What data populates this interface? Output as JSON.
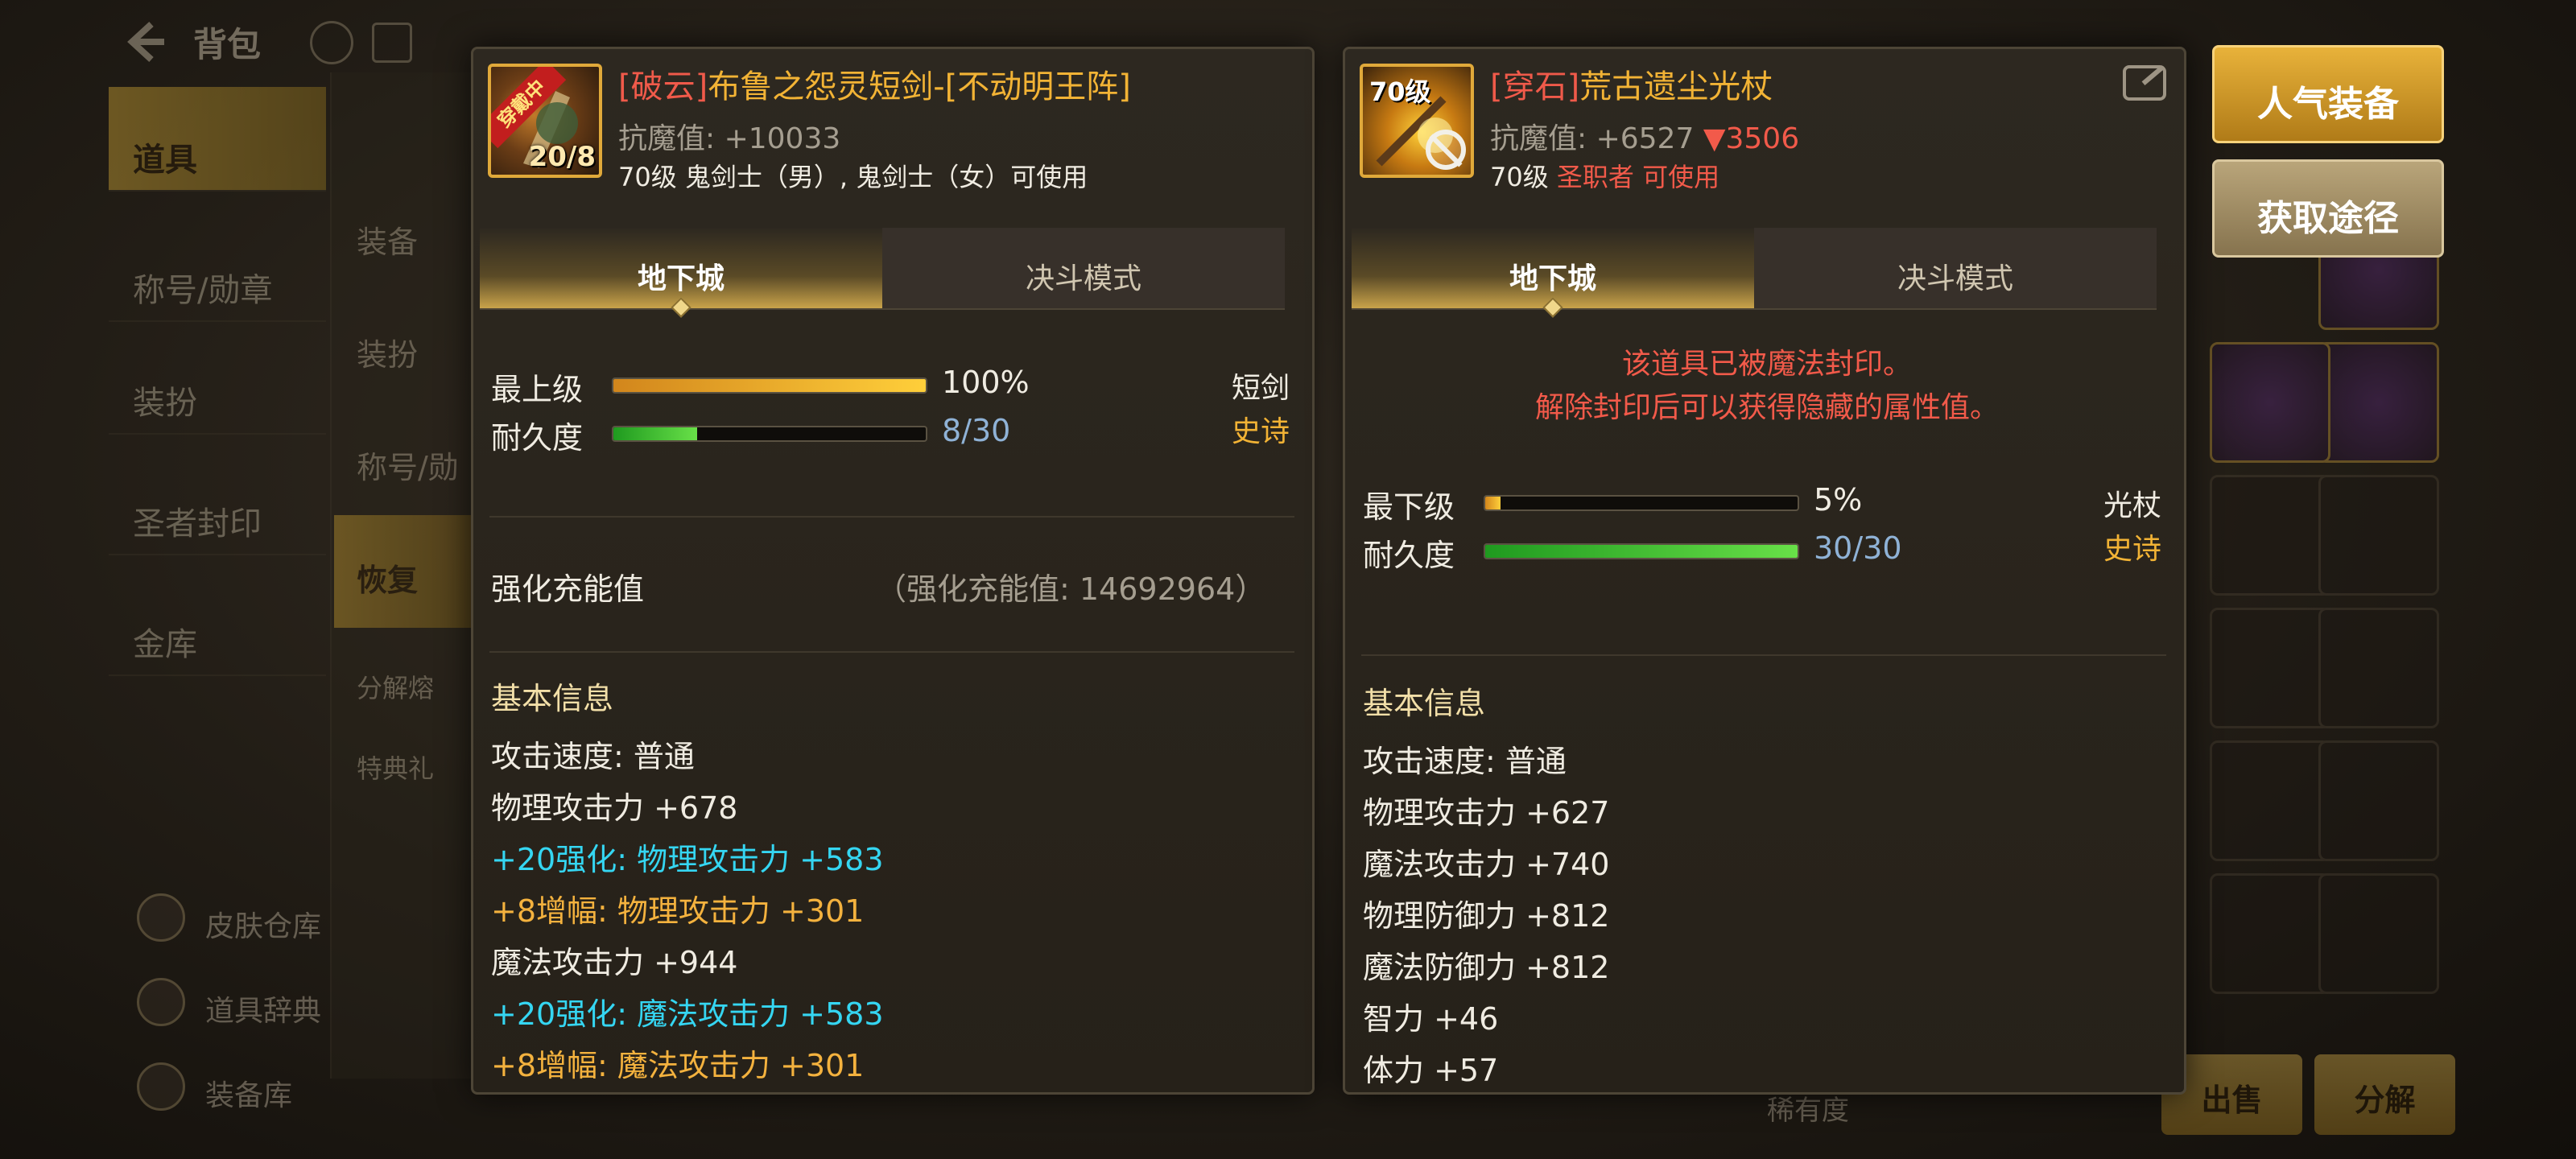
{
  "background": {
    "title": "背包",
    "side_menu": [
      "道具",
      "称号/勋章",
      "装扮",
      "圣者封印",
      "金库"
    ],
    "sub_menu": [
      "装备",
      "装扮",
      "称号/勋",
      "恢复",
      "分解熔",
      "特典礼"
    ],
    "bottom_side": [
      "皮肤仓库",
      "道具辞典",
      "装备库"
    ],
    "buttons": [
      "出售",
      "分解"
    ],
    "sort_label": "稀有度"
  },
  "left_panel": {
    "title_prefix": "[破云]",
    "title_main": "布鲁之怨灵短剑-[不动明王阵]",
    "icon_ribbon": "穿戴中",
    "icon_count": "20/8",
    "resist": "抗魔值: +10033",
    "usable": "70级 鬼剑士（男）, 鬼剑士（女）可使用",
    "tabs": [
      "地下城",
      "决斗模式"
    ],
    "stat1_label": "最上级",
    "stat1_value": "100%",
    "stat1_fill": 1.0,
    "stat2_label": "耐久度",
    "stat2_value": "8/30",
    "stat2_fill": 0.267,
    "category": "短剑",
    "rarity": "史诗",
    "enhance_label": "强化充能值",
    "enhance_value": "（强化充能值: 14692964）",
    "section_title": "基本信息",
    "lines": [
      {
        "text": "攻击速度: 普通",
        "color": "white"
      },
      {
        "text": "物理攻击力 +678",
        "color": "white"
      },
      {
        "text": "+20强化: 物理攻击力 +583",
        "color": "cyan"
      },
      {
        "text": " +8增幅: 物理攻击力 +301",
        "color": "orange"
      },
      {
        "text": "魔法攻击力 +944",
        "color": "white"
      },
      {
        "text": "+20强化: 魔法攻击力 +583",
        "color": "cyan"
      },
      {
        "text": " +8增幅: 魔法攻击力 +301",
        "color": "orange"
      }
    ]
  },
  "right_panel": {
    "title_prefix": "[穿石]",
    "title_main": "荒古遗尘光杖",
    "icon_level": "70级",
    "resist": "抗魔值: +6527",
    "resist_diff": "▼3506",
    "usable_level": "70级",
    "usable_class": "圣职者 可使用",
    "tabs": [
      "地下城",
      "决斗模式"
    ],
    "seal_line1": "该道具已被魔法封印。",
    "seal_line2": "解除封印后可以获得隐藏的属性值。",
    "stat1_label": "最下级",
    "stat1_value": "5%",
    "stat1_fill": 0.05,
    "stat2_label": "耐久度",
    "stat2_value": "30/30",
    "stat2_fill": 1.0,
    "category": "光杖",
    "rarity": "史诗",
    "section_title": "基本信息",
    "lines": [
      {
        "text": "攻击速度: 普通",
        "color": "white"
      },
      {
        "text": "物理攻击力 +627",
        "color": "white"
      },
      {
        "text": "魔法攻击力 +740",
        "color": "white"
      },
      {
        "text": "物理防御力 +812",
        "color": "white"
      },
      {
        "text": "魔法防御力 +812",
        "color": "white"
      },
      {
        "text": "智力 +46",
        "color": "white"
      },
      {
        "text": "体力 +57",
        "color": "white"
      }
    ]
  },
  "side_buttons": {
    "popular": "人气装备",
    "source": "获取途径"
  },
  "colors": {
    "accent_gold": "#f2b335",
    "title_red": "#f05a4a",
    "enhance_cyan": "#35d6f2",
    "amplify_orange": "#f4b23e"
  }
}
